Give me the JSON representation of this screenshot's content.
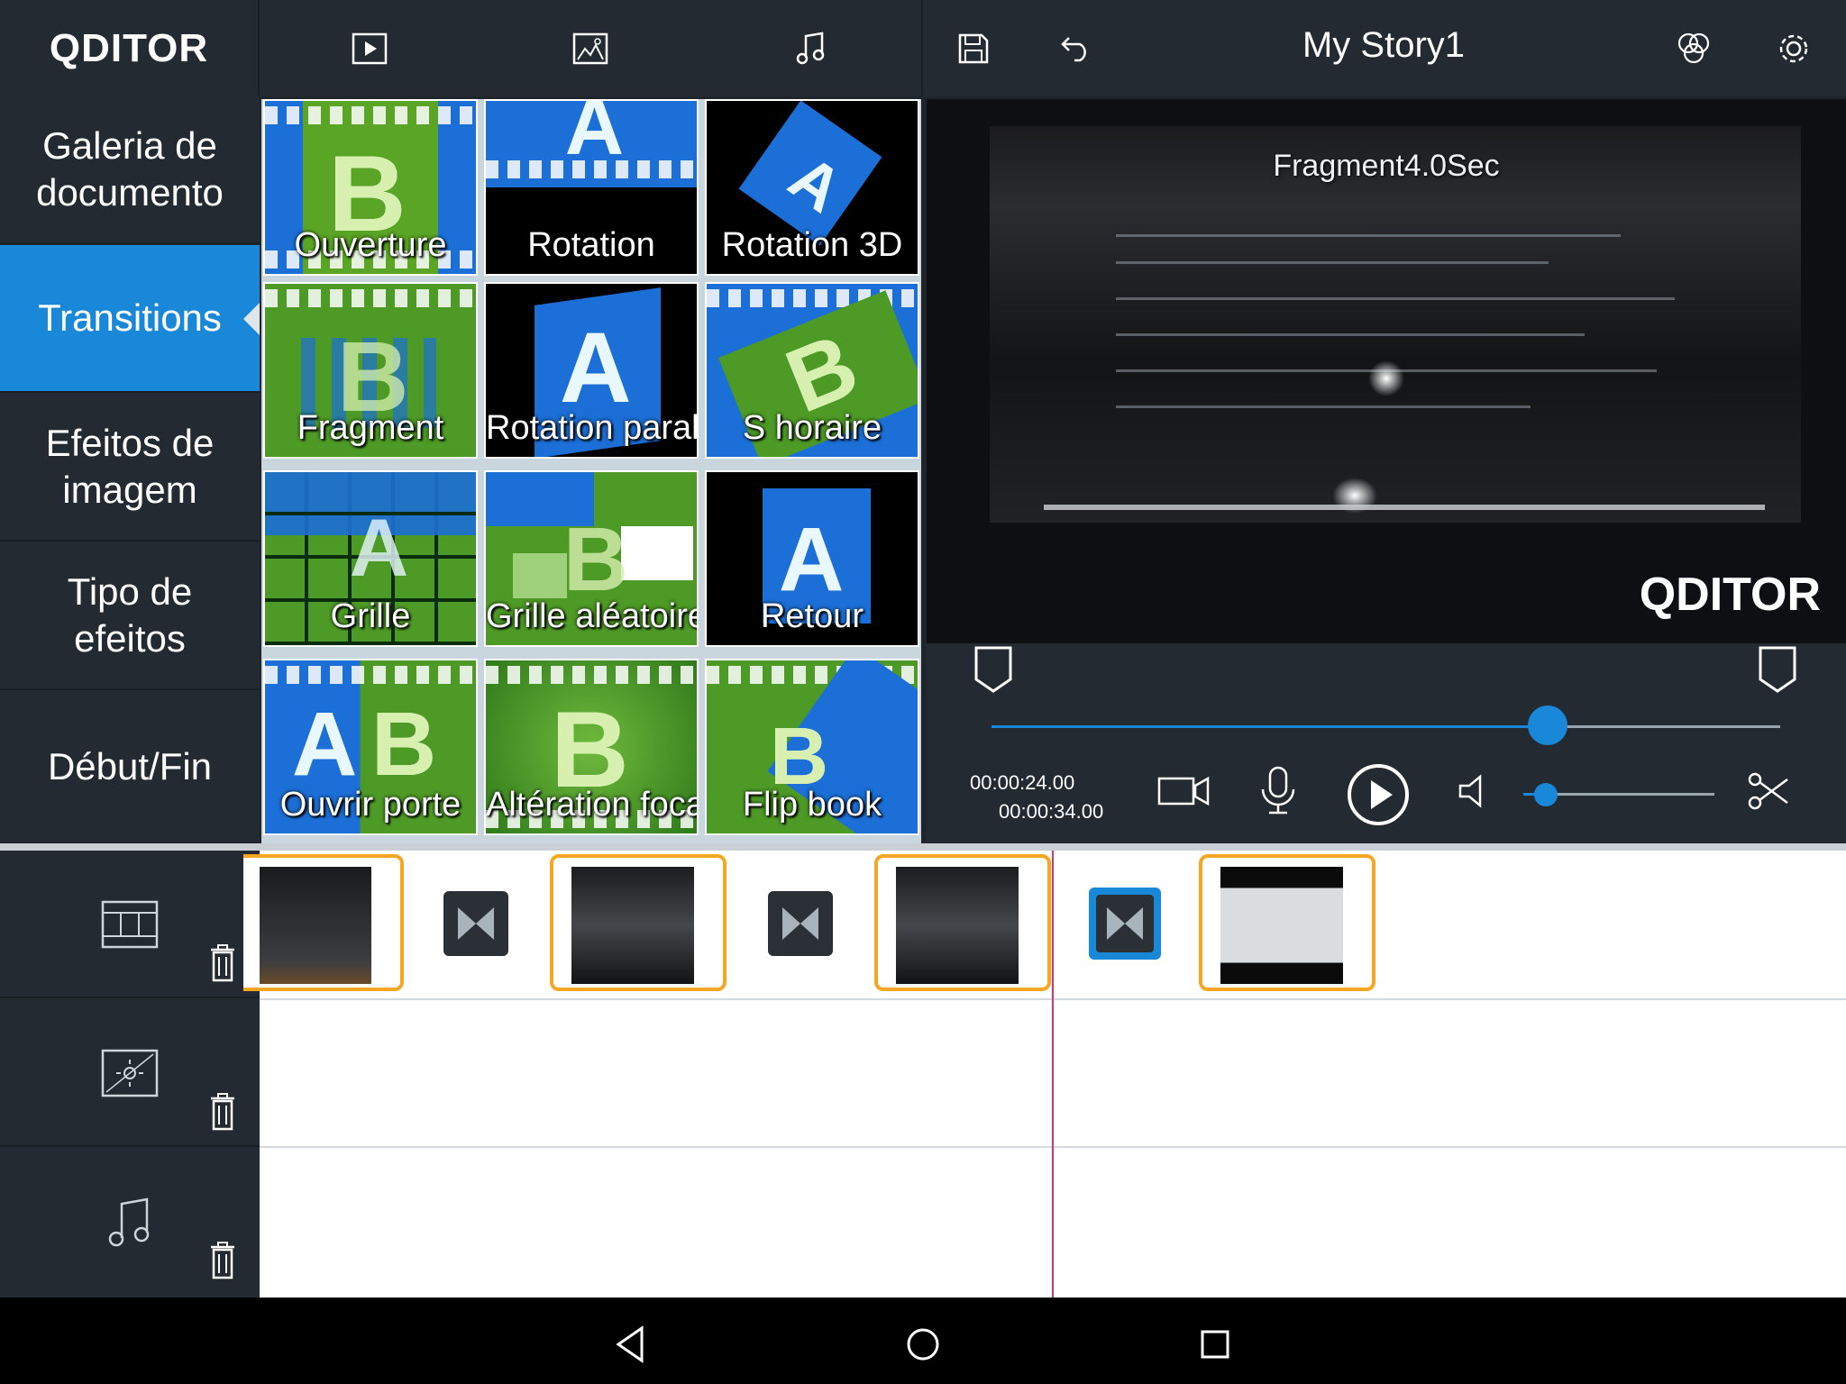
{
  "app": {
    "logo_text": "QDITOR",
    "story_title": "My Story1"
  },
  "toolbar": {
    "icons": [
      "video-preview-icon",
      "image-effect-icon",
      "music-note-icon",
      "save-icon",
      "undo-icon",
      "color-filter-icon",
      "settings-gear-icon"
    ]
  },
  "sidebar": {
    "items": [
      {
        "label": "Galeria de documento",
        "active": false
      },
      {
        "label": "Transitions",
        "active": true
      },
      {
        "label": "Efeitos de imagem",
        "active": false
      },
      {
        "label": "Tipo de efeitos",
        "active": false
      },
      {
        "label": "Début/Fin",
        "active": false
      }
    ]
  },
  "transitions": [
    {
      "label": "Ouverture",
      "style": "green-blue"
    },
    {
      "label": "Rotation",
      "style": "blue-black"
    },
    {
      "label": "Rotation 3D",
      "style": "black-blue"
    },
    {
      "label": "Fragment",
      "style": "green"
    },
    {
      "label": "Rotation paral",
      "style": "black-blue"
    },
    {
      "label": "S horaire",
      "style": "blue-green"
    },
    {
      "label": "Grille",
      "style": "grid"
    },
    {
      "label": "Grille aléatoire",
      "style": "grid"
    },
    {
      "label": "Retour",
      "style": "black-blue"
    },
    {
      "label": "Ouvrir porte",
      "style": "blue-green"
    },
    {
      "label": "Altération foca",
      "style": "green"
    },
    {
      "label": "Flip book",
      "style": "green-blue"
    }
  ],
  "preview": {
    "caption": "Fragment4.0Sec",
    "watermark": "QDITOR"
  },
  "playback": {
    "current_time": "00:00:24.00",
    "total_time": "00:00:34.00",
    "seek_fraction": 0.705,
    "volume_fraction": 0.12
  },
  "timeline": {
    "clips_count": 4,
    "selected_transition_index": 2
  },
  "colors": {
    "accent": "#1988d8",
    "clip_border": "#f5a623",
    "playhead": "#e0316a",
    "panel": "#232a31"
  }
}
